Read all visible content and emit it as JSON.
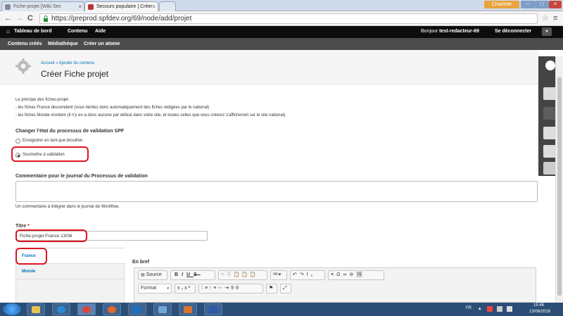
{
  "browser": {
    "tabs": [
      {
        "label": "Fiche-projet [Wiki Sec",
        "active": false
      },
      {
        "label": "Secours populaire | Créer",
        "active": true
      },
      {
        "label": "",
        "active": false
      }
    ],
    "user_chip": "Charlotte",
    "url": "https://preprod.spfdev.org/69/node/add/projet"
  },
  "admin_toolbar": {
    "left_items": [
      "Tableau de bord",
      "Contenu",
      "Aide"
    ],
    "greeting_prefix": "Bonjour ",
    "username": "test-redacteur-69",
    "logout": "Se déconnecter"
  },
  "shortcuts": [
    "Contenu créés",
    "Médiathèque",
    "Créer un atome"
  ],
  "header": {
    "breadcrumb": "Accueil » Ajouter du contenu",
    "title": "Créer Fiche projet"
  },
  "form": {
    "intro": [
      "Le principe des fiches-projet",
      "- les fiches France descendent (vous héritez donc automatiquement des fiches rédigées par le national)",
      "- les fiches Monde montent (il n'y en a donc aucune par défaut dans votre site, et toutes celles que vous créerez s'afficheront sur le site national)."
    ],
    "workflow_label": "Changer l'état du processus de validation SPF",
    "workflow_options": [
      {
        "label": "Enregistrer en tant que brouillon",
        "checked": false
      },
      {
        "label": "Soumettre à validation",
        "checked": true
      }
    ],
    "comment_label": "Commentaire pour le journal du Processus de validation",
    "comment_value": "",
    "comment_help": "Un commentaire à intégrer dans le journal de Workflow.",
    "title_label": "Titre",
    "title_required": "*",
    "title_value": "Fiche-projet France 13/06",
    "vertical_tabs": [
      {
        "label": "France",
        "active": true
      },
      {
        "label": "Monde",
        "active": false
      }
    ],
    "en_bref_label": "En bref",
    "editor_toolbar_row1": [
      "Source",
      "B",
      "I",
      "U",
      "S",
      "✂",
      "⎘",
      "📋",
      "📋",
      "📋",
      "ᵃᵇᶜ▾",
      "↶",
      "↷",
      "Iₓ",
      "≡",
      "Ω",
      "∞",
      "⊘",
      "🖼"
    ],
    "editor_toolbar_row2": [
      "Format",
      "x₂",
      "x²",
      "⁞≡",
      "⁝≡",
      "⇤",
      "⇥",
      "99",
      "⚑",
      "⤢"
    ]
  },
  "taskbar": {
    "lang": "FR",
    "time": "15:46",
    "date": "13/06/2016"
  },
  "colors": {
    "admin_bar": "#0d0d0d",
    "shortcut_bar": "#4c4c4c",
    "link": "#0074bd",
    "annotation_red": "#e0141e",
    "taskbar": "#2b4e76"
  }
}
